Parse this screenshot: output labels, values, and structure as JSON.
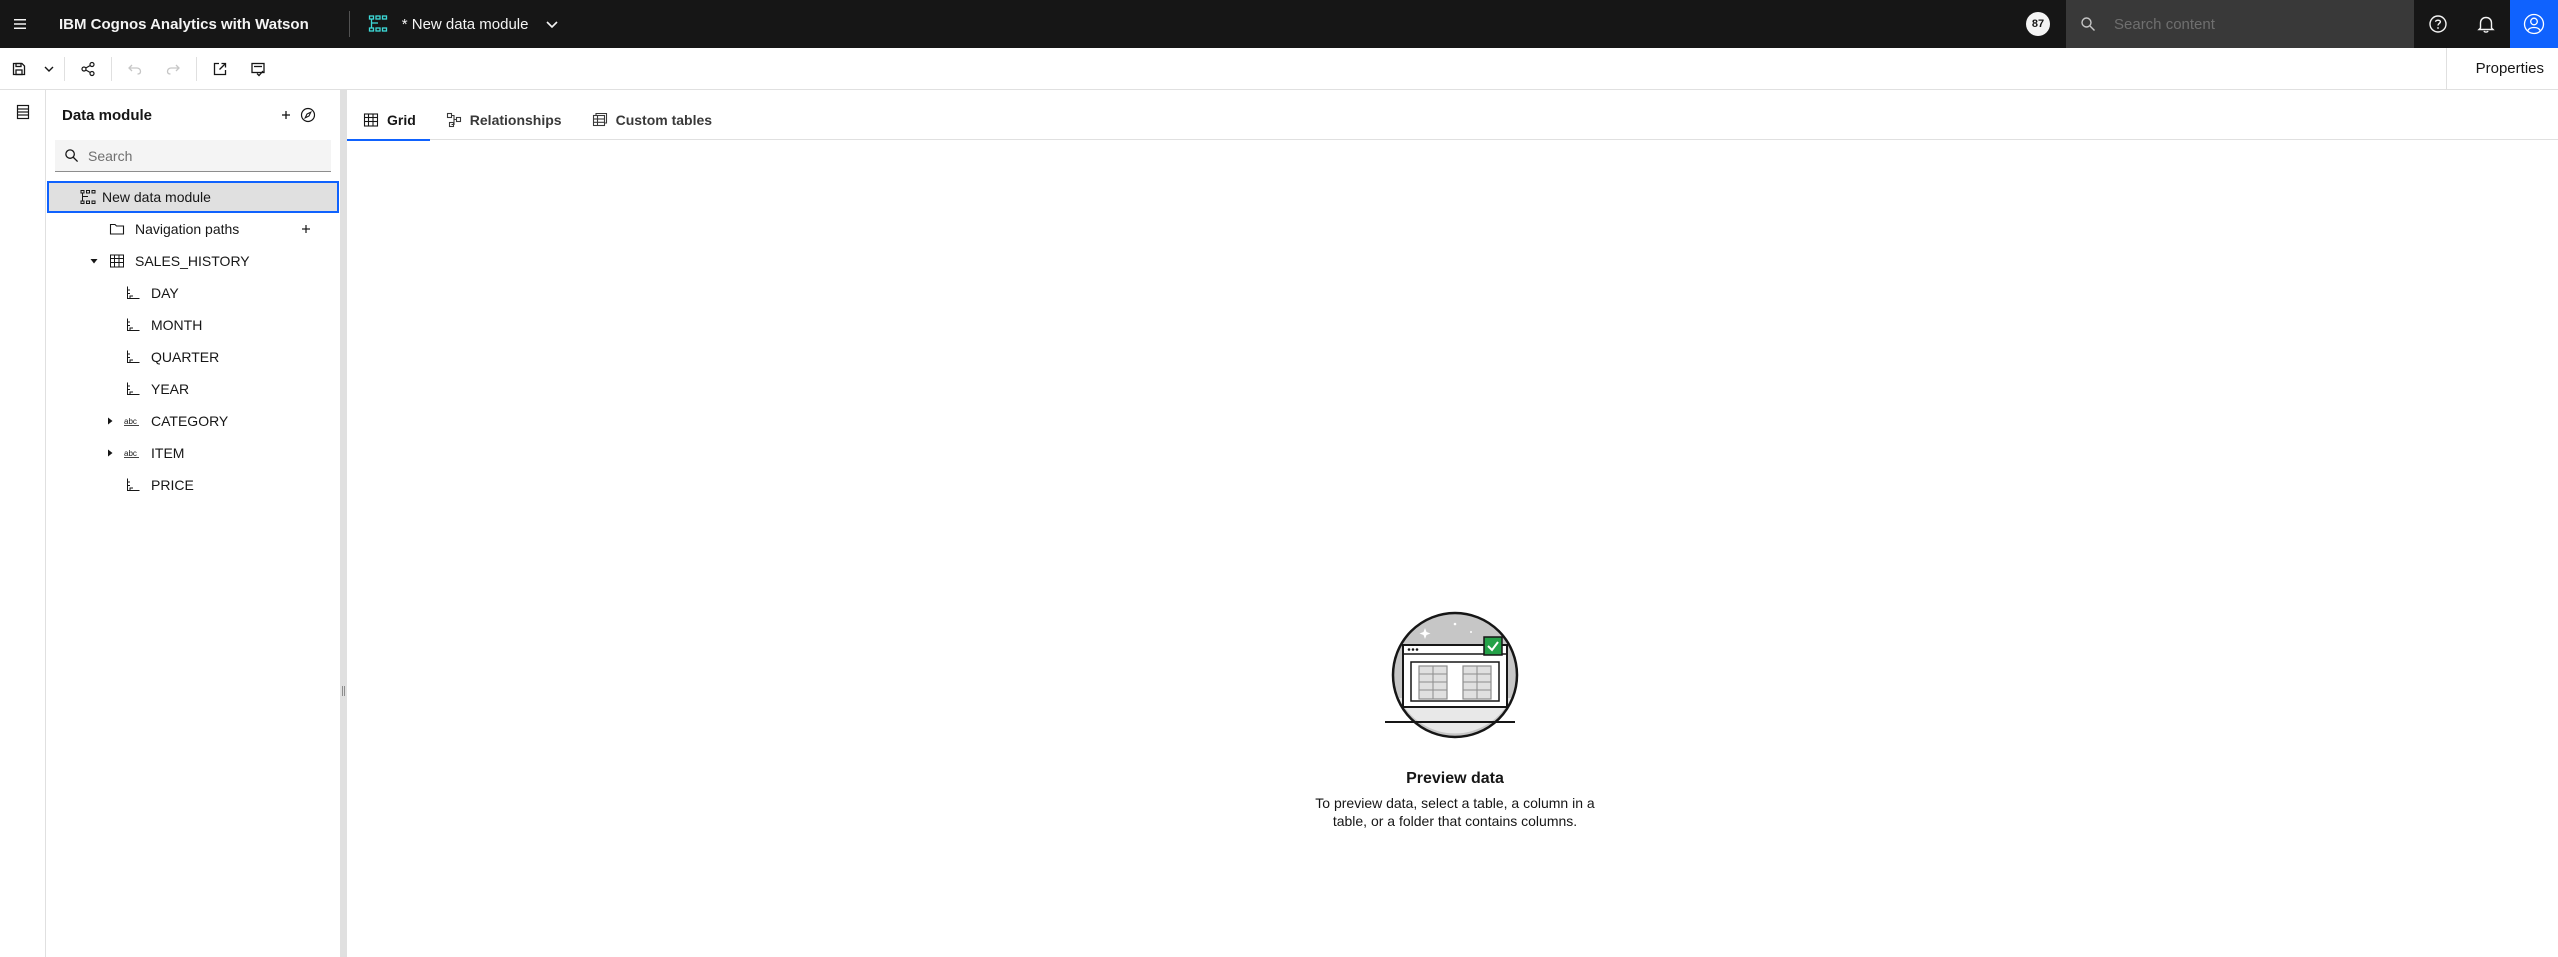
{
  "header": {
    "app_title": "IBM Cognos Analytics with Watson",
    "module_name": "* New data module",
    "badge_count": "87",
    "search_placeholder": "Search content"
  },
  "toolbar": {
    "properties_label": "Properties"
  },
  "panel": {
    "title": "Data module",
    "search_placeholder": "Search",
    "tree": [
      {
        "label": "New data module",
        "icon": "data-module-icon",
        "level": 0,
        "selected": true
      },
      {
        "label": "Navigation paths",
        "icon": "folder-icon",
        "level": 1
      },
      {
        "label": "SALES_HISTORY",
        "icon": "table-icon",
        "level": 1,
        "expanded": true
      },
      {
        "label": "DAY",
        "icon": "measure-icon",
        "level": 2
      },
      {
        "label": "MONTH",
        "icon": "measure-icon",
        "level": 2
      },
      {
        "label": "QUARTER",
        "icon": "measure-icon",
        "level": 2
      },
      {
        "label": "YEAR",
        "icon": "measure-icon",
        "level": 2
      },
      {
        "label": "CATEGORY",
        "icon": "text-attribute-icon",
        "level": 2,
        "collapsed": true
      },
      {
        "label": "ITEM",
        "icon": "text-attribute-icon",
        "level": 2,
        "collapsed": true
      },
      {
        "label": "PRICE",
        "icon": "measure-icon",
        "level": 2
      }
    ]
  },
  "tabs": [
    {
      "label": "Grid",
      "icon": "grid-icon",
      "active": true
    },
    {
      "label": "Relationships",
      "icon": "relationships-icon"
    },
    {
      "label": "Custom tables",
      "icon": "custom-tables-icon"
    }
  ],
  "empty_state": {
    "title": "Preview data",
    "line1": "To preview data, select a table, a column in a",
    "line2": "table, or a folder that contains columns."
  },
  "colors": {
    "header_bg": "#161616",
    "accent": "#0f62fe",
    "check_green": "#24a148"
  }
}
